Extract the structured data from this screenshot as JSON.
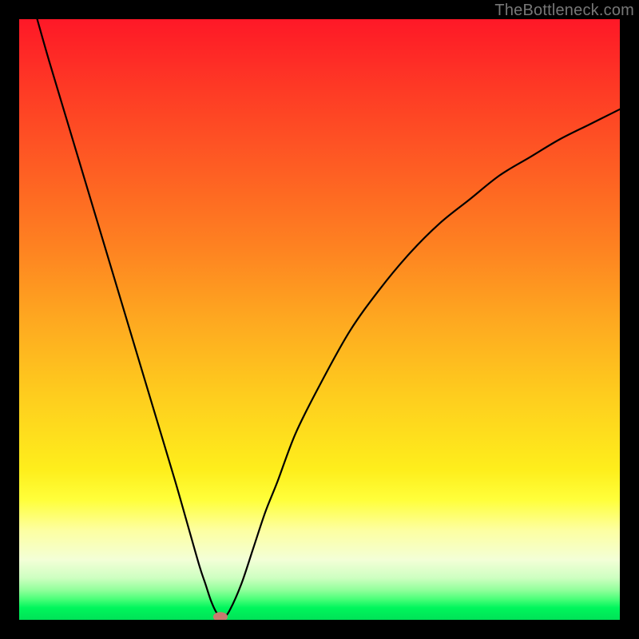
{
  "watermark": "TheBottleneck.com",
  "chart_data": {
    "type": "line",
    "title": "",
    "xlabel": "",
    "ylabel": "",
    "xlim": [
      0,
      100
    ],
    "ylim": [
      0,
      100
    ],
    "background_gradient": {
      "stops": [
        {
          "offset": 0.0,
          "color": "#fe1827"
        },
        {
          "offset": 0.12,
          "color": "#fe3b25"
        },
        {
          "offset": 0.25,
          "color": "#fe5e23"
        },
        {
          "offset": 0.38,
          "color": "#fe8221"
        },
        {
          "offset": 0.5,
          "color": "#fea820"
        },
        {
          "offset": 0.62,
          "color": "#fecb1e"
        },
        {
          "offset": 0.75,
          "color": "#feee1c"
        },
        {
          "offset": 0.8,
          "color": "#ffff3a"
        },
        {
          "offset": 0.85,
          "color": "#fdffa0"
        },
        {
          "offset": 0.9,
          "color": "#f3ffd7"
        },
        {
          "offset": 0.93,
          "color": "#ceffc1"
        },
        {
          "offset": 0.95,
          "color": "#93ff9c"
        },
        {
          "offset": 0.965,
          "color": "#4dff7a"
        },
        {
          "offset": 0.98,
          "color": "#00f65c"
        },
        {
          "offset": 1.0,
          "color": "#00e257"
        }
      ]
    },
    "series": [
      {
        "name": "bottleneck-curve",
        "color": "#000000",
        "x": [
          3,
          5,
          8,
          11,
          14,
          17,
          20,
          23,
          26,
          28,
          30,
          31,
          32,
          33,
          34,
          35,
          37,
          39,
          41,
          43,
          46,
          50,
          55,
          60,
          65,
          70,
          75,
          80,
          85,
          90,
          95,
          100
        ],
        "y": [
          100,
          93,
          83,
          73,
          63,
          53,
          43,
          33,
          23,
          16,
          9,
          6,
          3,
          1,
          0.5,
          1.5,
          6,
          12,
          18,
          23,
          31,
          39,
          48,
          55,
          61,
          66,
          70,
          74,
          77,
          80,
          82.5,
          85
        ]
      }
    ],
    "marker": {
      "name": "optimal-point",
      "x": 33.5,
      "y": 0.5,
      "rx": 1.2,
      "ry": 0.8,
      "color": "#c77a6f"
    }
  }
}
